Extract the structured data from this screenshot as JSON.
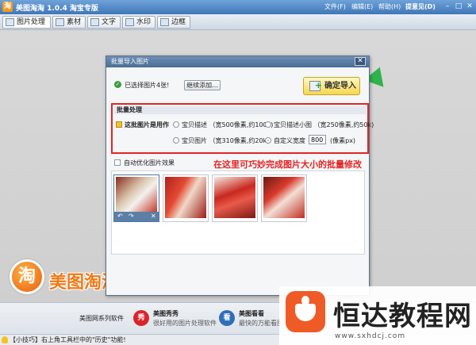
{
  "app": {
    "title": "美图淘淘 1.0.4 淘宝专版",
    "icon_letter": "淘",
    "menu": [
      {
        "label": "文件(F)"
      },
      {
        "label": "编辑(E)"
      },
      {
        "label": "帮助(H)"
      },
      {
        "label": "提意见(D)"
      }
    ],
    "window_buttons": [
      "–",
      "□",
      "✕"
    ]
  },
  "tabs": [
    {
      "label": "图片处理",
      "icon": "image-icon"
    },
    {
      "label": "素材",
      "icon": "material-icon"
    },
    {
      "label": "文字",
      "icon": "text-icon"
    },
    {
      "label": "水印",
      "icon": "watermark-icon"
    },
    {
      "label": "边框",
      "icon": "frame-icon"
    }
  ],
  "brand": {
    "logo_glyph": "淘",
    "text": "美图淘淘"
  },
  "dialog": {
    "title": "批量导入图片",
    "close": "✕",
    "selected_text": "已选择图片4张!",
    "continue_button": "继续添加...",
    "confirm_button": "确定导入",
    "batch": {
      "header": "批量处理",
      "use_as_label": "这批图片是用作",
      "options": [
        {
          "label": "宝贝描述 （宽500像素,约100k)",
          "selected": false
        },
        {
          "label": "宝贝描述小图 （宽250像素,约50k)",
          "selected": false
        },
        {
          "label": "宝贝图片 （宽310像素,约20k)",
          "selected": false
        },
        {
          "label": "自定义宽度",
          "selected": true
        }
      ],
      "custom_width_value": "800",
      "unit": "(像素px)"
    },
    "auto_optimize_label": "自动优化图片效果",
    "annotation": "在这里可巧妙完成图片大小的批量修改",
    "thumb_controls": [
      "↶",
      "↷",
      "✕"
    ],
    "thumbnail_count": 4
  },
  "bottom": {
    "series_label": "美图网系列软件",
    "products": [
      {
        "name": "美图秀秀",
        "desc": "很好用的图片处理软件",
        "glyph": "秀"
      },
      {
        "name": "美图看看",
        "desc": "最快的万能看图",
        "glyph": "看"
      }
    ]
  },
  "status": {
    "tip": "【小技巧】右上角工具栏中的\"历史\"功能!"
  },
  "watermark": {
    "text": "恒达教程网",
    "url": "www.sxhdcj.com"
  },
  "colors": {
    "titlebar": "#3f77b8",
    "highlight_red": "#e32424",
    "brand_orange": "#f07a16",
    "confirm_yellow": "#f7d64c",
    "watermark_orange": "#ef5b26"
  }
}
